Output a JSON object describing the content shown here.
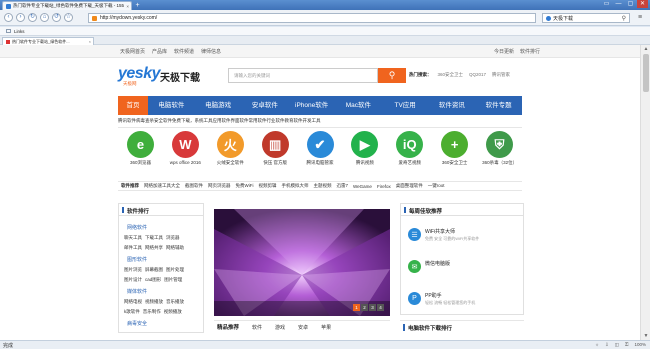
{
  "browser": {
    "tab_title": "热门软件专业下载站_绿色软件免费下载_天极下载 - 155浏览器",
    "tab_close": "×",
    "new_tab": "+",
    "window_controls": [
      "▭",
      "—",
      "▢",
      "✕"
    ],
    "address": "http://mydown.yesky.com/",
    "search_engine": "天极下载",
    "favbar_label": "Links",
    "tab2_title": "热门软件专业下载站_绿色软件...",
    "tab2_close": "×"
  },
  "page": {
    "top_links": [
      "天极网首页",
      "产品库",
      "软件频道",
      "律师信息"
    ],
    "top_right": [
      "今日更新",
      "软件排行"
    ],
    "logo_text": "yesky",
    "logo_sub": "天极网",
    "site_name": "天极下载",
    "search_placeholder": "请输入您的关键词",
    "search_button": "⚲",
    "hot_label": "热门搜索：",
    "hot_terms": [
      "360安全卫士",
      "QQ2017",
      "腾讯管家"
    ],
    "nav": [
      "首页",
      "电脑软件",
      "电脑游戏",
      "安卓软件",
      "iPhone软件",
      "Mac软件",
      "TV应用",
      "软件资讯",
      "软件专题"
    ],
    "notice": "腾讯软件病毒查杀安全软件免费下载，系统工具应用软件界面软件常用软件行业软件教育软件开发工具",
    "apps": [
      {
        "label": "360浏览器",
        "color": "#3fae3c",
        "glyph": "e"
      },
      {
        "label": "wps office 2016",
        "color": "#d8393a",
        "glyph": "W"
      },
      {
        "label": "火绒安全软件",
        "color": "#f29a2a",
        "glyph": "火"
      },
      {
        "label": "快压 官方版",
        "color": "#c0392b",
        "glyph": "▥"
      },
      {
        "label": "腾讯电脑管家",
        "color": "#2a8ad8",
        "glyph": "✔"
      },
      {
        "label": "腾讯视频",
        "color": "#22b24c",
        "glyph": "▶"
      },
      {
        "label": "爱奇艺视频",
        "color": "#36b24a",
        "glyph": "iQ"
      },
      {
        "label": "360安全卫士",
        "color": "#4cae2f",
        "glyph": "+"
      },
      {
        "label": "360杀毒（32位）",
        "color": "#3f9a4a",
        "glyph": "⛨"
      }
    ],
    "recommend_label": "软件推荐",
    "recommend": [
      "网络加速工具大全",
      "截图软件",
      "网页浏览器",
      "免费WiFi",
      "视频剪辑",
      "手机模拟大师",
      "主题视频",
      "迅雷7",
      "WeGame",
      "Firefox",
      "桌面整理软件",
      "一键root"
    ]
  },
  "left_col": {
    "title": "软件排行",
    "sections": [
      {
        "name": "网络软件",
        "rows": [
          [
            "聊天工具",
            "下载工具",
            "浏览器"
          ],
          [
            "邮件工具",
            "网络共享",
            "网络辅助"
          ]
        ]
      },
      {
        "name": "图形软件",
        "rows": [
          [
            "图片浏览",
            "屏幕截图",
            "图片处理"
          ],
          [
            "图片设计",
            "cad图形",
            "图片管理"
          ]
        ]
      },
      {
        "name": "媒体软件",
        "rows": [
          [
            "网络电视",
            "视频播放",
            "音乐播放"
          ],
          [
            "k歌软件",
            "音乐制作",
            "视频播放"
          ]
        ]
      },
      {
        "name": "病毒安全",
        "rows": []
      }
    ]
  },
  "slider": {
    "pages": [
      "1",
      "2",
      "3",
      "4"
    ],
    "current": "1"
  },
  "featured": {
    "title": "精品推荐",
    "tabs": [
      "软件",
      "游戏",
      "安卓",
      "苹果"
    ]
  },
  "right_col": {
    "title": "每周佳软推荐",
    "items": [
      {
        "name": "WiFi共享大师",
        "desc": "免费 安全 可靠的WiFi共享软件",
        "color": "#2a8ad8",
        "glyph": "☰"
      },
      {
        "name": "微信电脑版",
        "desc": "",
        "color": "#36b24a",
        "glyph": "✉"
      },
      {
        "name": "PP助手",
        "desc": "轻松 流畅 轻松管理您的手机",
        "color": "#2a8ad8",
        "glyph": "P"
      }
    ],
    "bottom_title": "电脑软件下载排行"
  },
  "status": {
    "left": "完成",
    "right": [
      "☼",
      "⇩",
      "◫",
      "⚿",
      "100%"
    ]
  }
}
